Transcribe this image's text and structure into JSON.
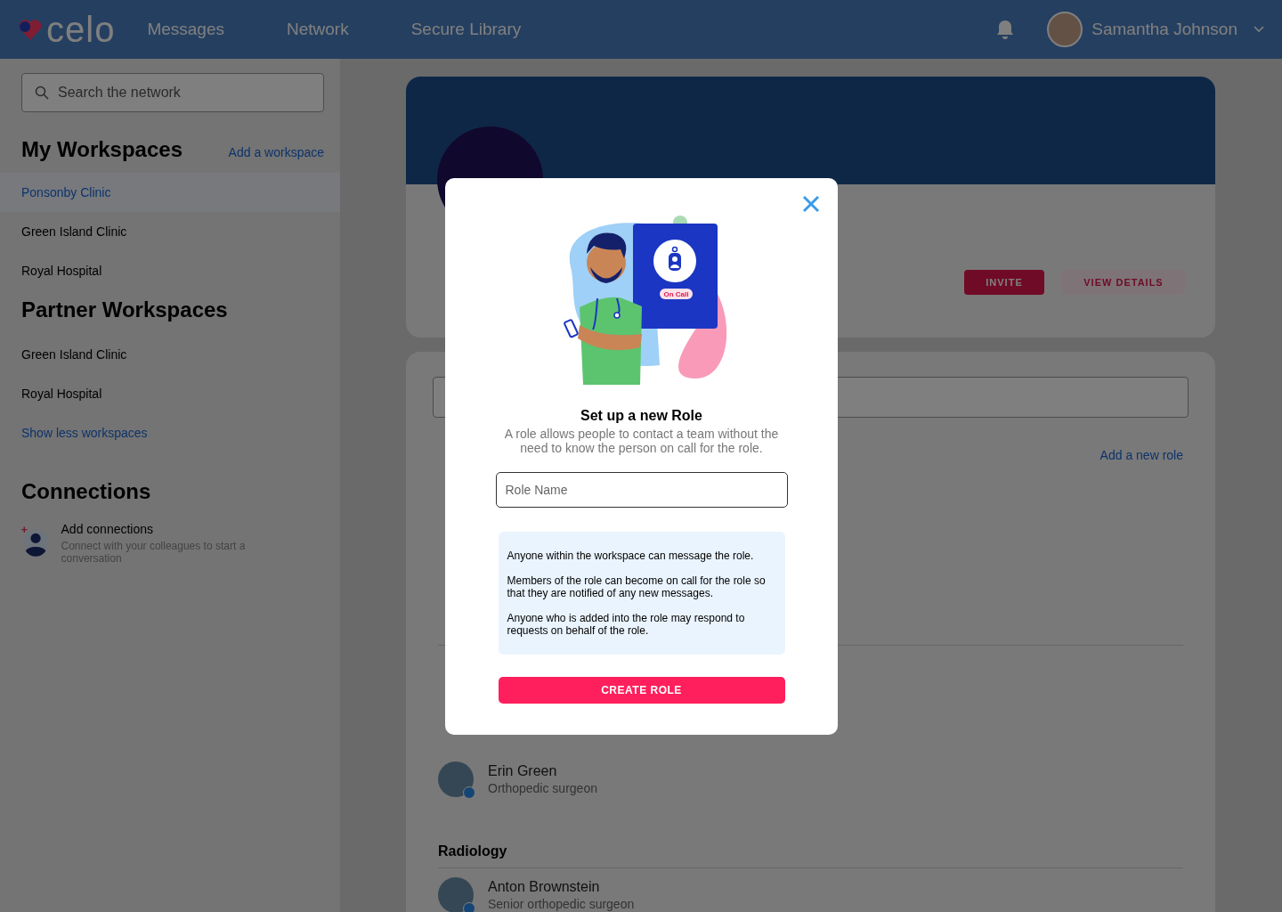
{
  "header": {
    "logo": "celo",
    "nav": [
      {
        "label": "Messages"
      },
      {
        "label": "Network"
      },
      {
        "label": "Secure Library"
      }
    ],
    "user": {
      "name": "Samantha Johnson"
    }
  },
  "sidebar": {
    "search": {
      "placeholder": "Search the network"
    },
    "my_workspaces": {
      "title": "My Workspaces",
      "action": "Add a workspace",
      "items": [
        {
          "label": "Ponsonby Clinic",
          "selected": true
        },
        {
          "label": "Green Island Clinic",
          "selected": false
        },
        {
          "label": "Royal Hospital",
          "selected": false
        }
      ]
    },
    "partner_workspaces": {
      "title": "Partner Workspaces",
      "items": [
        {
          "label": "Green Island Clinic",
          "selected": false
        },
        {
          "label": "Royal Hospital",
          "selected": false
        }
      ]
    },
    "toggle": "Show less workspaces",
    "connections": {
      "title": "Connections",
      "item": {
        "title": "Add connections",
        "subtitle": "Connect with your colleagues to start a conversation"
      }
    }
  },
  "main": {
    "profile": {
      "buttons": [
        {
          "kind": "primary",
          "label": "INVITE"
        },
        {
          "kind": "secondary",
          "label": "VIEW DETAILS"
        }
      ]
    },
    "roles": {
      "action": "Add a new role"
    },
    "groups": [
      {
        "members": [
          {
            "name": "Erin Green",
            "role": "Orthopedic surgeon",
            "verified": true
          }
        ]
      },
      {
        "name": "Radiology",
        "members": [
          {
            "name": "Anton Brownstein",
            "role": "Senior orthopedic surgeon",
            "verified": true
          }
        ]
      }
    ]
  },
  "modal": {
    "badge": "On Call",
    "title": "Set up a new Role",
    "description": "A role allows people to contact a team without the need to know the person on call for the role.",
    "field": {
      "placeholder": "Role Name"
    },
    "info": [
      "Anyone within the workspace can message the role.",
      "Members of the role can become on call for the role so that they are notified of any new messages.",
      "Anyone who is added into the role may respond to requests on behalf of the role."
    ],
    "button": "CREATE ROLE"
  }
}
